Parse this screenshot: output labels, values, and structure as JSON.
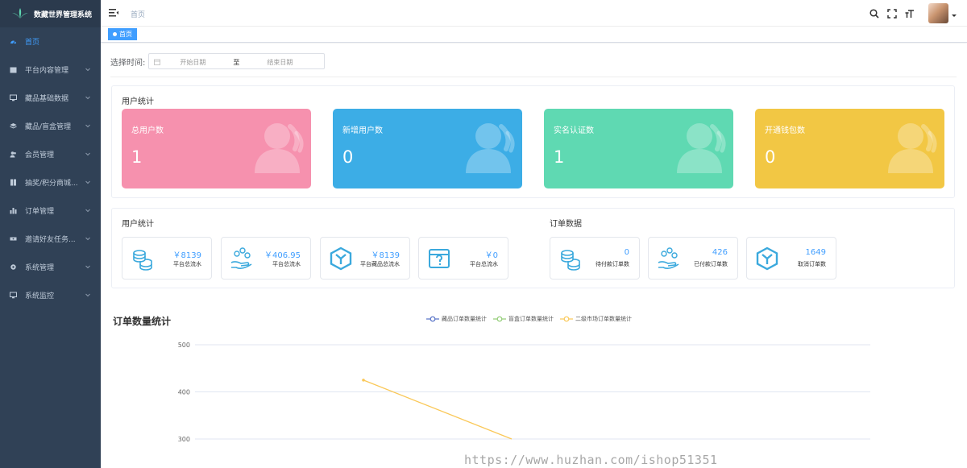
{
  "sidebar": {
    "title": "数藏世界管理系统",
    "items": [
      {
        "label": "首页",
        "icon": "dashboard-icon",
        "active": true,
        "expandable": false
      },
      {
        "label": "平台内容管理",
        "icon": "calendar-icon",
        "expandable": true
      },
      {
        "label": "藏品基础数据",
        "icon": "monitor-icon",
        "expandable": true
      },
      {
        "label": "藏品/盲盒管理",
        "icon": "layers-icon",
        "expandable": true
      },
      {
        "label": "会员管理",
        "icon": "users-icon",
        "expandable": true
      },
      {
        "label": "抽奖/积分商城...",
        "icon": "book-icon",
        "expandable": true
      },
      {
        "label": "订单管理",
        "icon": "bar-chart-icon",
        "expandable": true
      },
      {
        "label": "邀请好友任务...",
        "icon": "ticket-icon",
        "expandable": true
      },
      {
        "label": "系统管理",
        "icon": "gear-icon",
        "expandable": true
      },
      {
        "label": "系统监控",
        "icon": "monitor-icon",
        "expandable": true
      }
    ]
  },
  "navbar": {
    "breadcrumb": "首页"
  },
  "tags": {
    "active": "首页"
  },
  "filter": {
    "label": "选择时间:",
    "start_placeholder": "开始日期",
    "separator": "至",
    "end_placeholder": "结束日期"
  },
  "user_stats": {
    "title": "用户统计",
    "cards": [
      {
        "label": "总用户数",
        "value": "1",
        "color": "#f691ae"
      },
      {
        "label": "新增用户数",
        "value": "0",
        "color": "#3cade6"
      },
      {
        "label": "实名认证数",
        "value": "1",
        "color": "#5fd9b2"
      },
      {
        "label": "开通钱包数",
        "value": "0",
        "color": "#f2c744"
      }
    ]
  },
  "finance_stats": {
    "title": "用户统计",
    "items": [
      {
        "value": "￥8139",
        "label": "平台总流水",
        "icon": "coins-icon"
      },
      {
        "value": "￥406.95",
        "label": "平台总流水",
        "icon": "hand-money-icon"
      },
      {
        "value": "￥8139",
        "label": "平台藏品总流水",
        "icon": "cube-icon"
      },
      {
        "value": "￥0",
        "label": "平台总流水",
        "icon": "mystery-box-icon"
      }
    ]
  },
  "order_stats": {
    "title": "订单数据",
    "items": [
      {
        "value": "0",
        "label": "待付款订单数",
        "icon": "coins-icon"
      },
      {
        "value": "426",
        "label": "已付款订单数",
        "icon": "hand-money-icon"
      },
      {
        "value": "1649",
        "label": "取消订单数",
        "icon": "cube-icon"
      }
    ]
  },
  "chart_data": {
    "type": "line",
    "title": "订单数量统计",
    "series": [
      {
        "name": "藏品订单数量统计",
        "color": "#5470c6",
        "values": []
      },
      {
        "name": "盲盒订单数量统计",
        "color": "#91cc75",
        "values": []
      },
      {
        "name": "二级市场订单数量统计",
        "color": "#fac858",
        "values": [
          425,
          300
        ]
      }
    ],
    "y_ticks": [
      500,
      400,
      300
    ],
    "ylim": [
      300,
      500
    ]
  },
  "watermark": "https://www.huzhan.com/ishop51351",
  "colors": {
    "sidebar_bg": "#304156",
    "accent": "#409eff"
  }
}
